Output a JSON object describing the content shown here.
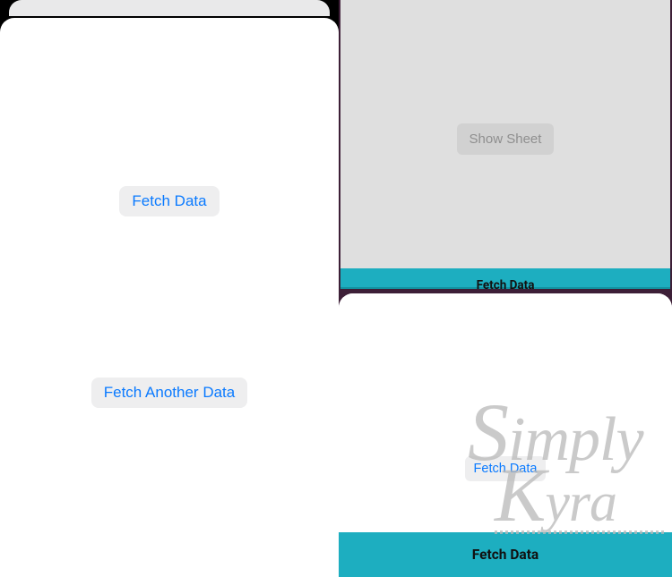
{
  "left_sheet": {
    "fetch_data_label": "Fetch Data",
    "fetch_another_label": "Fetch Another Data"
  },
  "right_top": {
    "show_sheet_label": "Show Sheet",
    "teal_title": "Fetch Data"
  },
  "right_bottom": {
    "fetch_data_label": "Fetch Data",
    "teal_title": "Fetch Data"
  },
  "watermark": {
    "line1_cap": "S",
    "line1_rest": "imply",
    "line2_cap": "K",
    "line2_rest": "yra"
  }
}
